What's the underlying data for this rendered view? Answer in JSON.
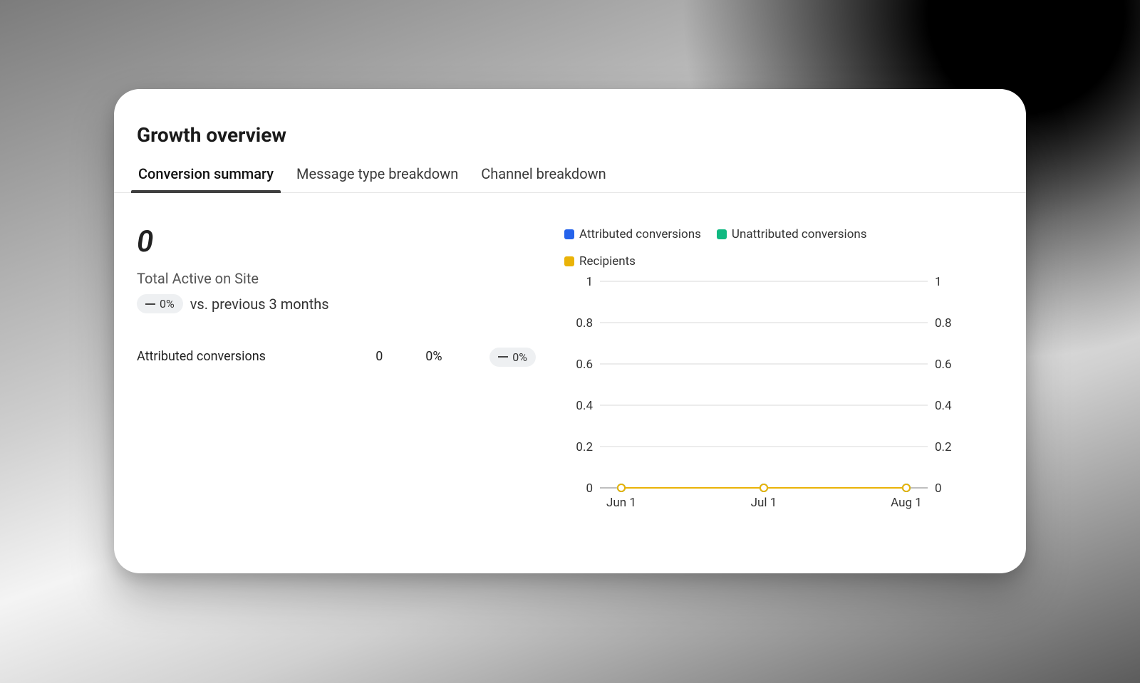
{
  "title": "Growth overview",
  "tabs": [
    {
      "label": "Conversion summary",
      "active": true
    },
    {
      "label": "Message type breakdown",
      "active": false
    },
    {
      "label": "Channel breakdown",
      "active": false
    }
  ],
  "metric": {
    "value": "0",
    "name": "Total Active on Site",
    "change_pill": "0%",
    "comparison_text": "vs. previous 3 months"
  },
  "row": {
    "label": "Attributed conversions",
    "value": "0",
    "percent": "0%",
    "change_pill": "0%"
  },
  "legend": [
    {
      "label": "Attributed conversions",
      "color": "#2563eb"
    },
    {
      "label": "Unattributed conversions",
      "color": "#10b981"
    },
    {
      "label": "Recipients",
      "color": "#eab308"
    }
  ],
  "chart_data": {
    "type": "line",
    "categories": [
      "Jun 1",
      "Jul 1",
      "Aug 1"
    ],
    "series": [
      {
        "name": "Attributed conversions",
        "color": "#2563eb",
        "values": [
          0,
          0,
          0
        ]
      },
      {
        "name": "Unattributed conversions",
        "color": "#10b981",
        "values": [
          0,
          0,
          0
        ]
      },
      {
        "name": "Recipients",
        "color": "#eab308",
        "values": [
          0,
          0,
          0
        ]
      }
    ],
    "ylim_left": [
      0,
      1
    ],
    "ylim_right": [
      0,
      1
    ],
    "yticks_left": [
      "0",
      "0.2",
      "0.4",
      "0.6",
      "0.8",
      "1"
    ],
    "yticks_right": [
      "0",
      "0.2",
      "0.4",
      "0.6",
      "0.8",
      "1"
    ],
    "title": "",
    "xlabel": "",
    "ylabel": ""
  }
}
